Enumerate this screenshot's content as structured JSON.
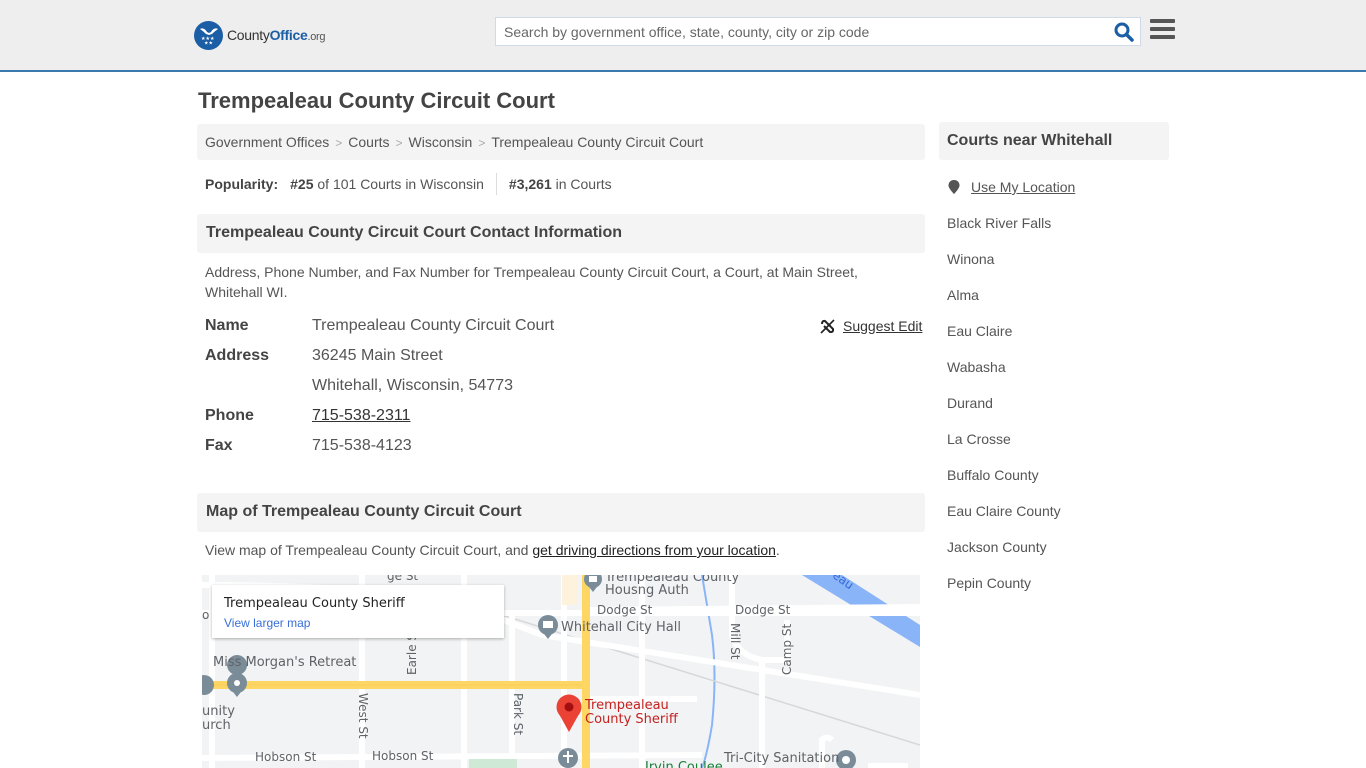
{
  "header": {
    "logo": {
      "part1": "County",
      "part2": "Office",
      "part3": ".org"
    },
    "search": {
      "placeholder": "Search by government office, state, county, city or zip code",
      "value": ""
    },
    "icons": {
      "search": "search-icon",
      "menu": "hamburger-menu-icon"
    }
  },
  "page": {
    "title": "Trempealeau County Circuit Court",
    "breadcrumb": [
      "Government Offices",
      "Courts",
      "Wisconsin",
      "Trempealeau County Circuit Court"
    ],
    "popularity": {
      "label": "Popularity:",
      "state_rank": "#25",
      "state_text": "of 101 Courts in Wisconsin",
      "national_rank": "#3,261",
      "national_text": "in Courts"
    }
  },
  "contact": {
    "heading": "Trempealeau County Circuit Court Contact Information",
    "description": "Address, Phone Number, and Fax Number for Trempealeau County Circuit Court, a Court, at Main Street, Whitehall WI.",
    "suggest_edit": "Suggest Edit",
    "rows": {
      "name_label": "Name",
      "name": "Trempealeau County Circuit Court",
      "address_label": "Address",
      "address1": "36245 Main Street",
      "address2": "Whitehall, Wisconsin, 54773",
      "phone_label": "Phone",
      "phone": "715-538-2311",
      "fax_label": "Fax",
      "fax": "715-538-4123"
    }
  },
  "map_section": {
    "heading": "Map of Trempealeau County Circuit Court",
    "desc_prefix": "View map of Trempealeau County Circuit Court, and ",
    "desc_link": "get driving directions from your location",
    "desc_suffix": ".",
    "infobox": {
      "title": "Trempealeau County Sheriff",
      "link": "View larger map"
    },
    "labels": {
      "housing1": "Trempealeau County",
      "housing2": "Housng Auth",
      "dodge1": "Dodge St",
      "dodge2": "Dodge St",
      "cityhall": "Whitehall City Hall",
      "morgan": "Miss Morgan's Retreat",
      "earle": "Earle St",
      "west": "West St",
      "park": "Park St",
      "mill": "Mill St",
      "camp": "Camp St",
      "hobson1": "Hobson St",
      "hobson2": "Hobson St",
      "sheriff1": "Trempealeau",
      "sheriff2": "County Sheriff",
      "sanitation": "Tri-City Sanitation",
      "irvin": "Irvin Coulee",
      "church1": "unity",
      "church2": "urch",
      "river": "eau",
      "partial_st": "ge St",
      "partial_so": "o"
    }
  },
  "sidebar": {
    "heading": "Courts near Whitehall",
    "use_location": "Use My Location",
    "links": [
      "Black River Falls",
      "Winona",
      "Alma",
      "Eau Claire",
      "Wabasha",
      "Durand",
      "La Crosse",
      "Buffalo County",
      "Eau Claire County",
      "Jackson County",
      "Pepin County"
    ]
  },
  "colors": {
    "brand_blue": "#1b5ea6",
    "header_bg": "#eeeeee",
    "header_border": "#3a7ab0",
    "panel_bg": "#f4f4f4",
    "map_road": "#fdd663",
    "map_pin": "#ea4335"
  }
}
